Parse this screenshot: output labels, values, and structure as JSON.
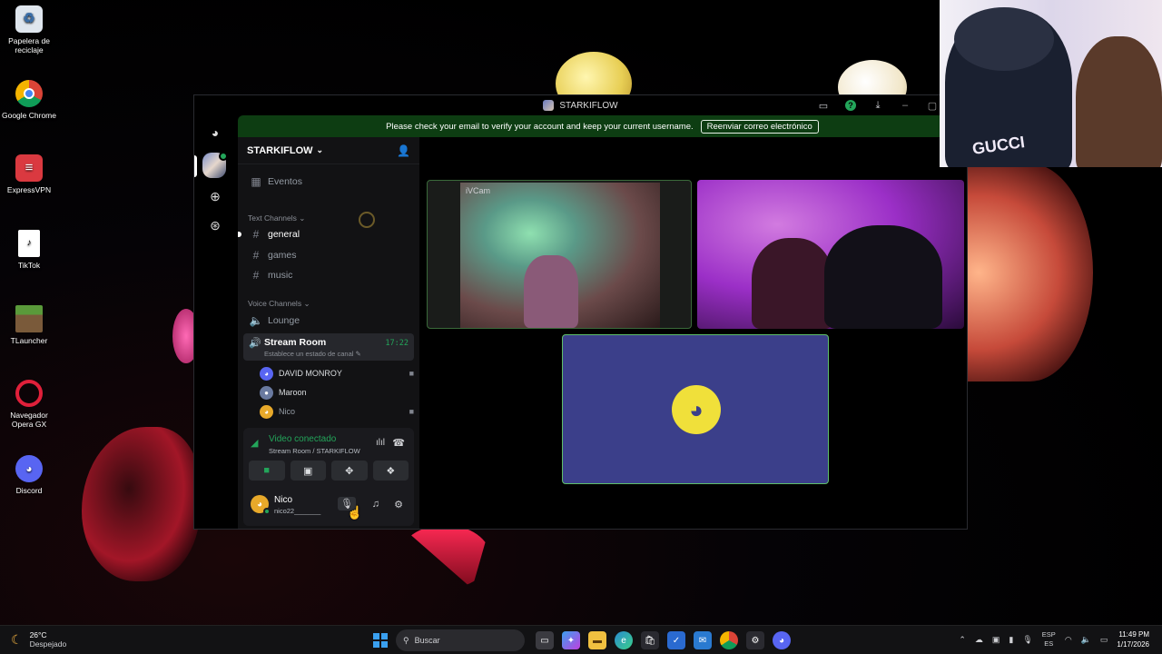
{
  "desktop": {
    "icons": [
      {
        "label": "Papelera de reciclaje",
        "icon": "recycle-bin-icon"
      },
      {
        "label": "Google Chrome",
        "icon": "chrome-icon"
      },
      {
        "label": "ExpressVPN",
        "icon": "expressvpn-icon"
      },
      {
        "label": "TikTok",
        "icon": "tiktok-file-icon"
      },
      {
        "label": "TLauncher",
        "icon": "tlauncher-icon"
      },
      {
        "label": "Navegador Opera GX",
        "icon": "opera-gx-icon"
      },
      {
        "label": "Discord",
        "icon": "discord-icon"
      }
    ]
  },
  "window": {
    "title": "STARKIFLOW"
  },
  "notice": {
    "text": "Please check your email to verify your account and keep your current username.",
    "button": "Reenviar correo electrónico"
  },
  "server": {
    "name": "STARKIFLOW",
    "events": "Eventos",
    "text_category": "Text Channels",
    "text_channels": [
      "general",
      "games",
      "music"
    ],
    "voice_category": "Voice Channels",
    "voice_channels": {
      "lounge": "Lounge",
      "stream_room": "Stream Room",
      "stream_status": "Establece un estado de canal",
      "stream_time": "17:22"
    },
    "voice_users": [
      "DAVID MONROY",
      "Maroon",
      "Nico"
    ]
  },
  "voice_panel": {
    "title": "Video conectado",
    "subtitle": "Stream Room / STARKIFLOW"
  },
  "user": {
    "name": "Nico",
    "tag": "nico22_______"
  },
  "stage": {
    "tile1_label": "iVCam"
  },
  "webcam_overlay": {
    "shirt_text": "GUCCI"
  },
  "taskbar": {
    "weather_temp": "26°C",
    "weather_desc": "Despejado",
    "search_placeholder": "Buscar",
    "lang_top": "ESP",
    "lang_bottom": "ES",
    "time": "11:49 PM",
    "date": "1/17/2026"
  },
  "colors": {
    "accent_green": "#23a55a",
    "discord_blurple": "#5865f2",
    "notice_bg": "#0d3d12"
  }
}
